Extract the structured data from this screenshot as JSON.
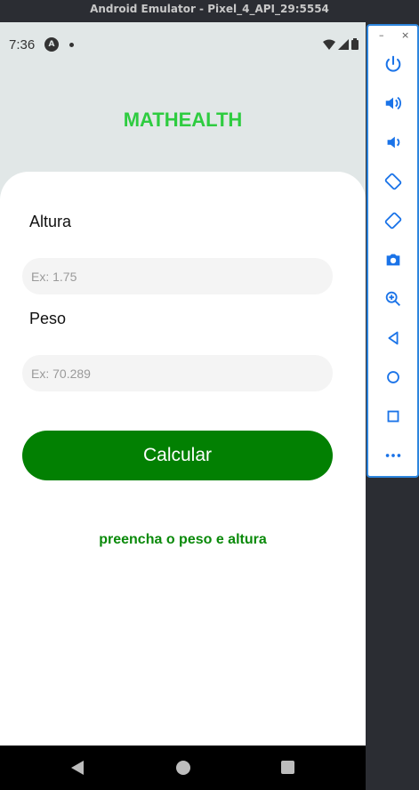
{
  "window": {
    "title": "Android Emulator - Pixel_4_API_29:5554"
  },
  "statusbar": {
    "time": "7:36",
    "app_badge": "A"
  },
  "app": {
    "title": "MATHEALTH"
  },
  "form": {
    "altura_label": "Altura",
    "altura_placeholder": "Ex: 1.75",
    "peso_label": "Peso",
    "peso_placeholder": "Ex: 70.289",
    "button_label": "Calcular",
    "message": "preencha o peso e altura"
  },
  "toolbar": {
    "items": [
      "power-icon",
      "volume-up-icon",
      "volume-down-icon",
      "rotate-left-icon",
      "rotate-right-icon",
      "camera-icon",
      "zoom-icon",
      "back-icon",
      "home-icon",
      "overview-icon",
      "more-icon"
    ]
  },
  "colors": {
    "title_green": "#2ecc40",
    "button_green": "#028002",
    "message_green": "#0a8a0a",
    "header_bg": "#e1e7e7",
    "toolbar_border": "#2e86de"
  }
}
